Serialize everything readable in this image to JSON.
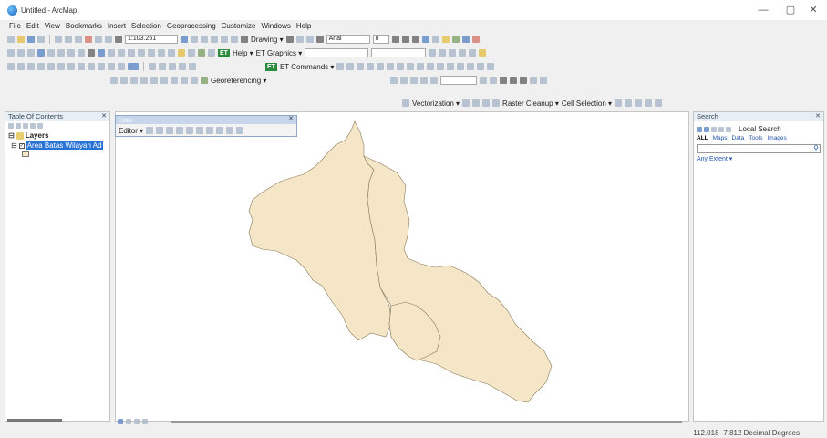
{
  "window": {
    "title": "Untitled - ArcMap",
    "minimize": "—",
    "maximize": "▢",
    "close": "✕"
  },
  "menu": [
    "File",
    "Edit",
    "View",
    "Bookmarks",
    "Insert",
    "Selection",
    "Geoprocessing",
    "Customize",
    "Windows",
    "Help"
  ],
  "toolbar": {
    "scale": "1:103.251",
    "drawing": "Drawing ▾",
    "font": "Arial",
    "font_size": "8",
    "help": "Help ▾",
    "et_graphics": "ET Graphics ▾",
    "et_commands": "ET Commands ▾",
    "georeferencing": "Georeferencing ▾",
    "vectorization": "Vectorization ▾",
    "raster_cleanup": "Raster Cleanup ▾",
    "cell_selection": "Cell Selection ▾",
    "et_badge": "ET"
  },
  "toc": {
    "title": "Table Of Contents",
    "close": "✕",
    "layers_label": "Layers",
    "layer_name": "Area Batas Wilayah Ad"
  },
  "map": {
    "editor_window_title": "Editor",
    "editor_label": "Editor ▾",
    "polygon_fill": "#f5e6c8",
    "polygon_stroke": "#8a7a5a"
  },
  "search": {
    "title": "Search",
    "close": "✕",
    "local_search": "Local Search",
    "tabs": [
      "ALL",
      "Maps",
      "Data",
      "Tools",
      "Images"
    ],
    "search_icon": "magnifier-icon",
    "any_extent": "Any Extent ▾"
  },
  "status": {
    "coordinates": "112.018  -7.812 Decimal Degrees"
  }
}
